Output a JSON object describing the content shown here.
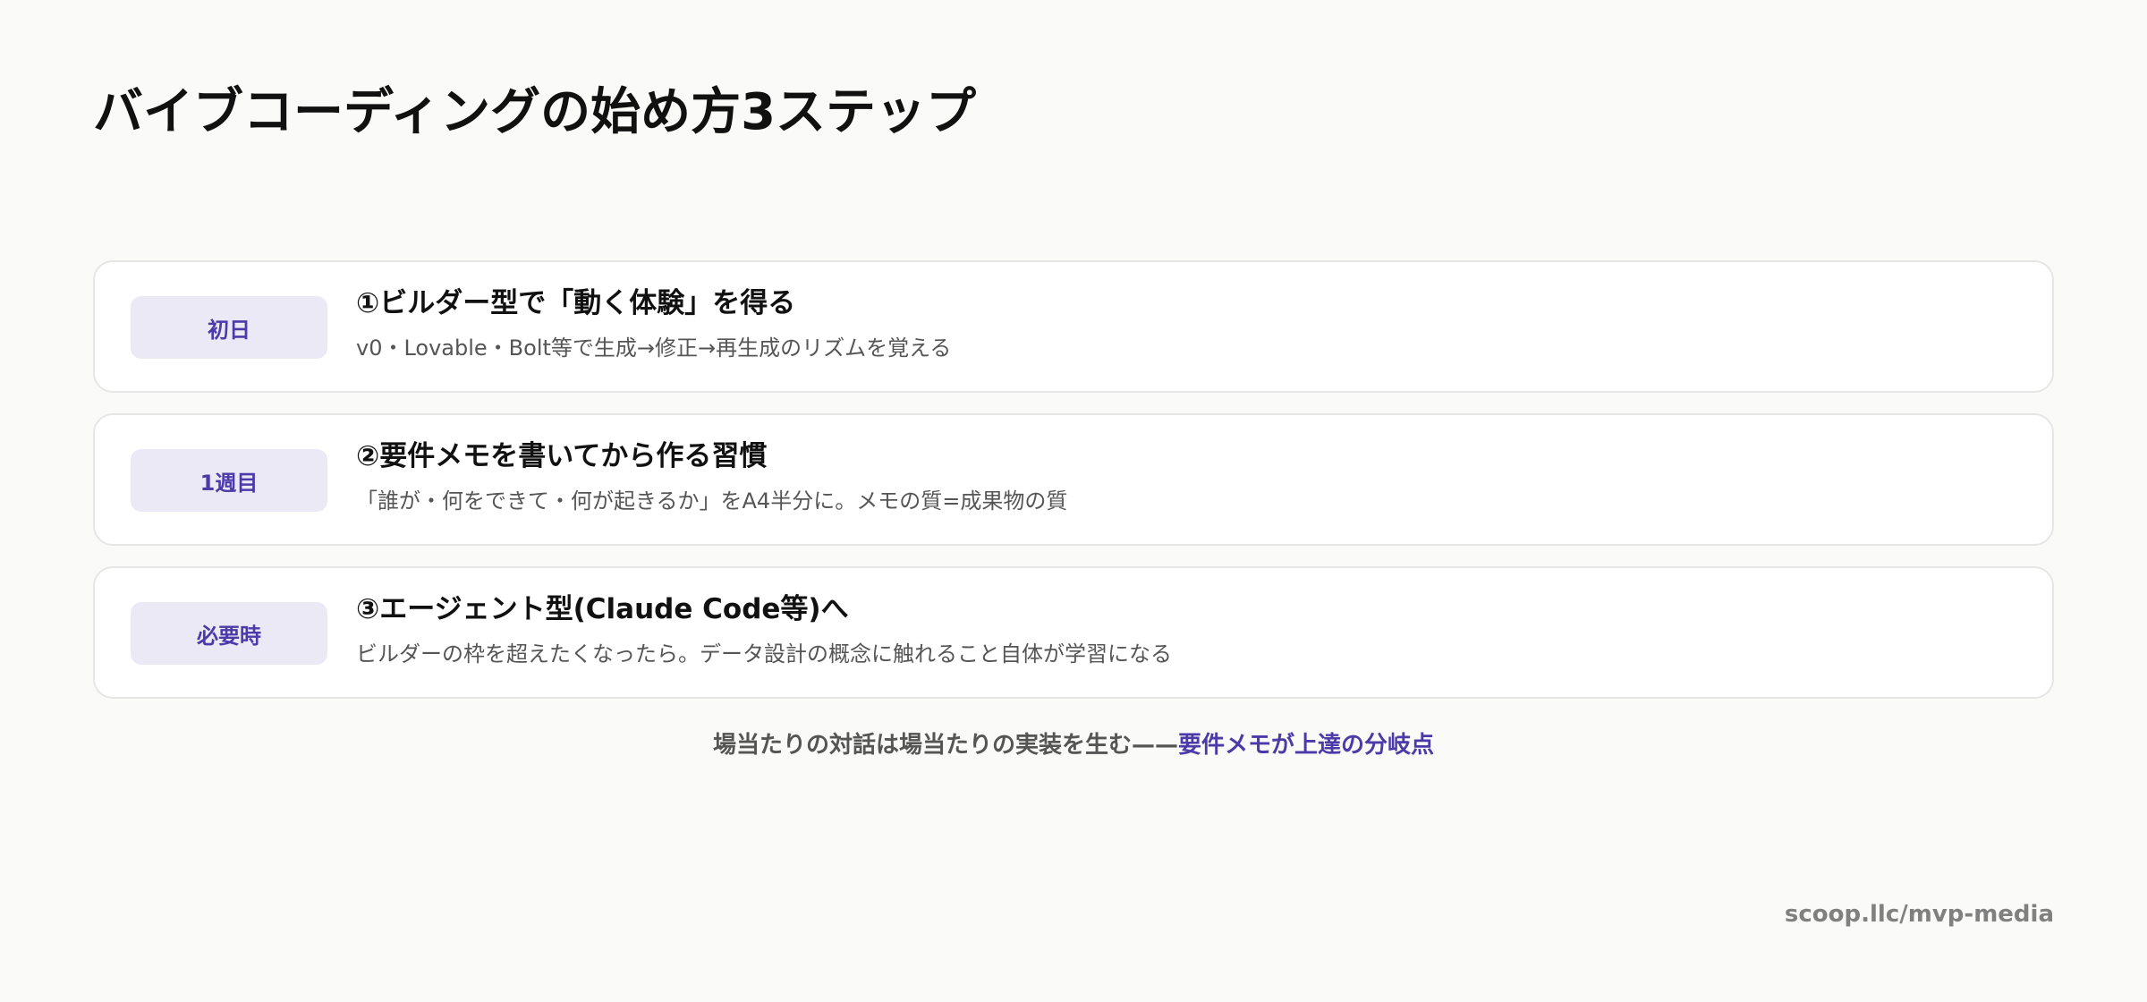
{
  "title": "バイブコーディングの始め方3ステップ",
  "steps": [
    {
      "badge": "初日",
      "heading": "①ビルダー型で「動く体験」を得る",
      "description": "v0・Lovable・Bolt等で生成→修正→再生成のリズムを覚える"
    },
    {
      "badge": "1週目",
      "heading": "②要件メモを書いてから作る習慣",
      "description": "「誰が・何をできて・何が起きるか」をA4半分に。メモの質=成果物の質"
    },
    {
      "badge": "必要時",
      "heading": "③エージェント型(Claude Code等)へ",
      "description": "ビルダーの枠を超えたくなったら。データ設計の概念に触れること自体が学習になる"
    }
  ],
  "footer": {
    "text": "場当たりの対話は場当たりの実装を生む——",
    "highlight": "要件メモが上達の分岐点"
  },
  "source": "scoop.llc/mvp-media",
  "colors": {
    "background": "#fafaf8",
    "accent": "#4b3aa8",
    "badge_background": "#ece9f6"
  }
}
